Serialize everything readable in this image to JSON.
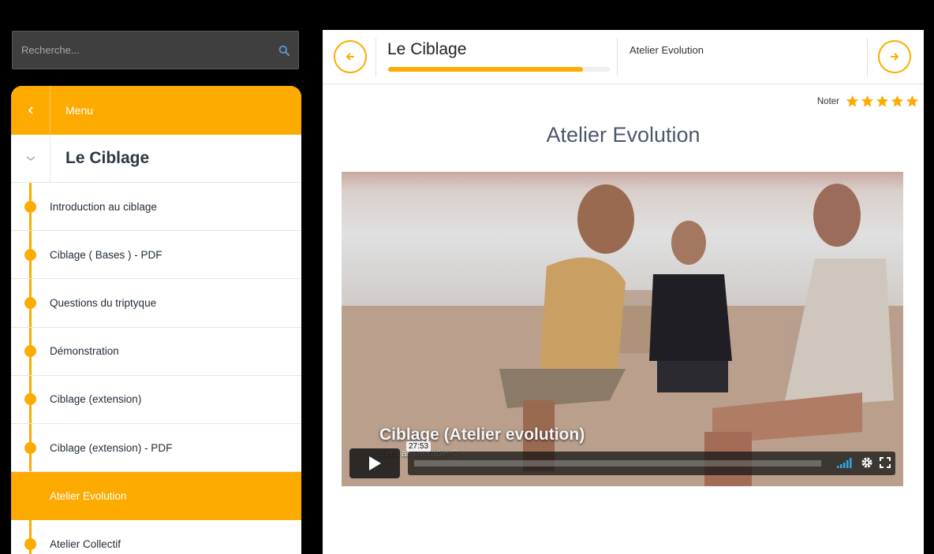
{
  "search": {
    "placeholder": "Recherche..."
  },
  "sidebar": {
    "menu_label": "Menu",
    "course_title": "Le Ciblage",
    "items": [
      {
        "label": "Introduction au ciblage"
      },
      {
        "label": "Ciblage ( Bases ) - PDF"
      },
      {
        "label": "Questions du triptyque"
      },
      {
        "label": "Démonstration"
      },
      {
        "label": "Ciblage (extension)"
      },
      {
        "label": "Ciblage (extension) - PDF"
      },
      {
        "label": "Atelier Evolution"
      },
      {
        "label": "Atelier Collectif"
      }
    ],
    "active_index": 6
  },
  "topbar": {
    "title": "Le Ciblage",
    "progress": 0.88,
    "current": "Atelier Evolution"
  },
  "rating": {
    "label": "Noter",
    "stars": 5
  },
  "content": {
    "heading": "Atelier Evolution"
  },
  "video": {
    "caption": "Ciblage (Atelier evolution)",
    "subcaption": "Zéro        al Thérapie ©",
    "time": "27:53"
  },
  "colors": {
    "accent": "#fdab00",
    "sidebar_text": "#1f2a36",
    "heading": "#4b5868"
  },
  "icons": {
    "search": "search-icon",
    "back": "chevron-left-icon",
    "toggle": "chevron-down-icon",
    "prev": "arrow-left-icon",
    "next": "arrow-right-icon",
    "star": "star-icon",
    "play": "play-icon",
    "volume": "volume-icon",
    "settings": "gear-icon",
    "fullscreen": "fullscreen-icon"
  }
}
